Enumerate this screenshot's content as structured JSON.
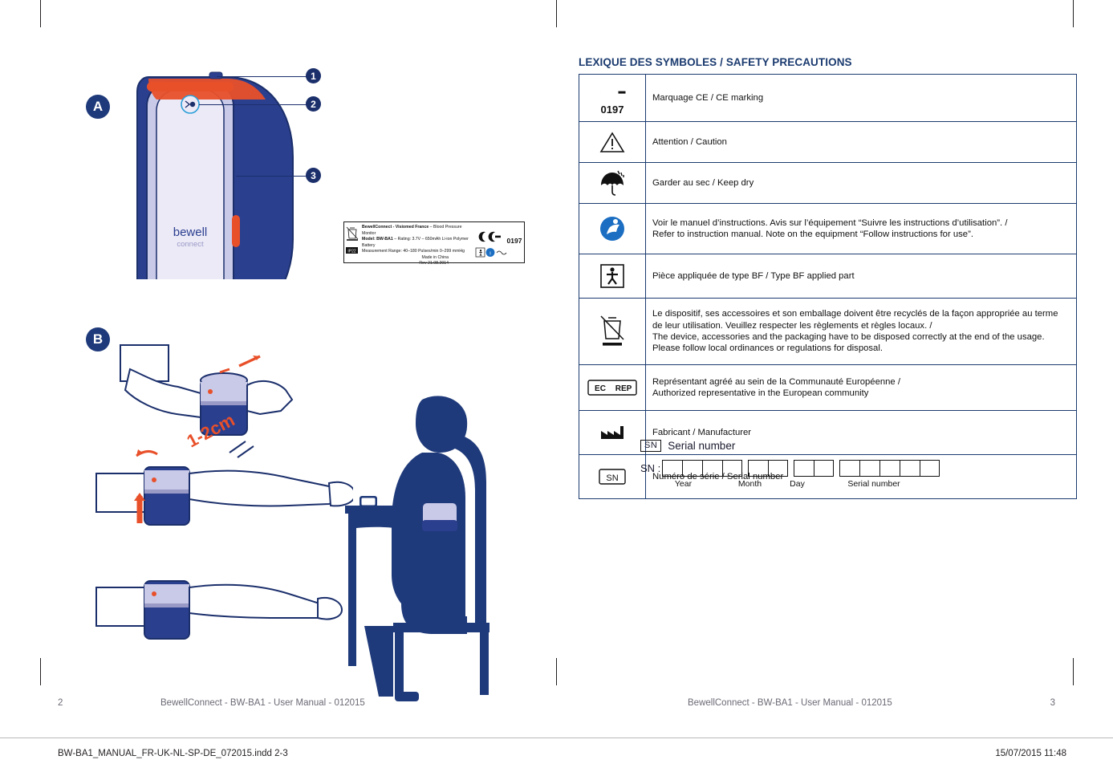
{
  "document": {
    "left_page": {
      "page_number": "2",
      "footer": "BewellConnect - BW-BA1 - User Manual - 012015",
      "figure_badges": [
        "A",
        "B"
      ],
      "callouts": [
        "1",
        "2",
        "3"
      ],
      "annotation": "1-2cm",
      "product_label": {
        "line1_bold": "BewellConnect - Visiomed France",
        "line1_rest": " – Blood Pressure Monitor",
        "line2_bold": "Model: BW-BA1",
        "line2_rest": " – Rating: 3.7V – 650mAh Li-ion Polymer Battery",
        "line3": "Measurement Range: 40–180 Pulses/min 0–299 mmHg",
        "line4": "Made in China",
        "line5": "Rev 21.08.2014",
        "ce_number": "0197",
        "ip_code": "IP22"
      }
    },
    "right_page": {
      "page_number": "3",
      "footer": "BewellConnect - BW-BA1 - User Manual - 012015",
      "title": "LEXIQUE DES SYMBOLES / SAFETY PRECAUTIONS",
      "symbol_rows": [
        {
          "icon": "ce-mark-icon",
          "icon_text": "0197",
          "text": "Marquage CE / CE marking"
        },
        {
          "icon": "warning-triangle-icon",
          "icon_text": "",
          "text": "Attention / Caution"
        },
        {
          "icon": "keep-dry-umbrella-icon",
          "icon_text": "",
          "text": "Garder au sec / Keep dry"
        },
        {
          "icon": "consult-instructions-icon",
          "icon_text": "",
          "text": "Voir le manuel d’instructions.  Avis sur l’équipement “Suivre les instructions d’utilisation”. /\nRefer to instruction manual. Note on the equipment “Follow instructions for use”."
        },
        {
          "icon": "type-bf-applied-part-icon",
          "icon_text": "",
          "text": "Pièce appliquée de type BF / Type BF applied part"
        },
        {
          "icon": "weee-crossed-bin-icon",
          "icon_text": "",
          "text": "Le dispositif, ses accessoires et son emballage doivent être recyclés de la façon appropriée au terme de leur utilisation.  Veuillez respecter les règlements et règles locaux. /\nThe device, accessories and the packaging have to be disposed correctly at the end of the usage. Please follow local ordinances or regulations for disposal."
        },
        {
          "icon": "ec-rep-icon",
          "icon_text": "EC   REP",
          "text": "Représentant agréé au sein de la Communauté Européenne /\nAuthorized representative in the European community"
        },
        {
          "icon": "manufacturer-factory-icon",
          "icon_text": "",
          "text": "Fabricant / Manufacturer"
        },
        {
          "icon": "serial-number-sn-icon",
          "icon_text": "SN",
          "text": "Numéro de série / Serial number"
        }
      ],
      "serial_block": {
        "tag": "SN",
        "title": "Serial number",
        "prefix": "SN :",
        "groups": [
          4,
          2,
          2,
          5
        ],
        "group_labels": [
          "Year",
          "Month",
          "Day",
          "Serial number"
        ]
      }
    },
    "print_bar": {
      "left": "BW-BA1_MANUAL_FR-UK-NL-SP-DE_072015.indd   2-3",
      "right": "15/07/2015   11:48"
    }
  },
  "colors": {
    "brand_blue": "#1b3b6f",
    "deep_navy": "#1f3a7a",
    "accent_orange": "#e8502a",
    "lavender": "#b9b9e0",
    "footer_gray": "#6a6a75"
  }
}
